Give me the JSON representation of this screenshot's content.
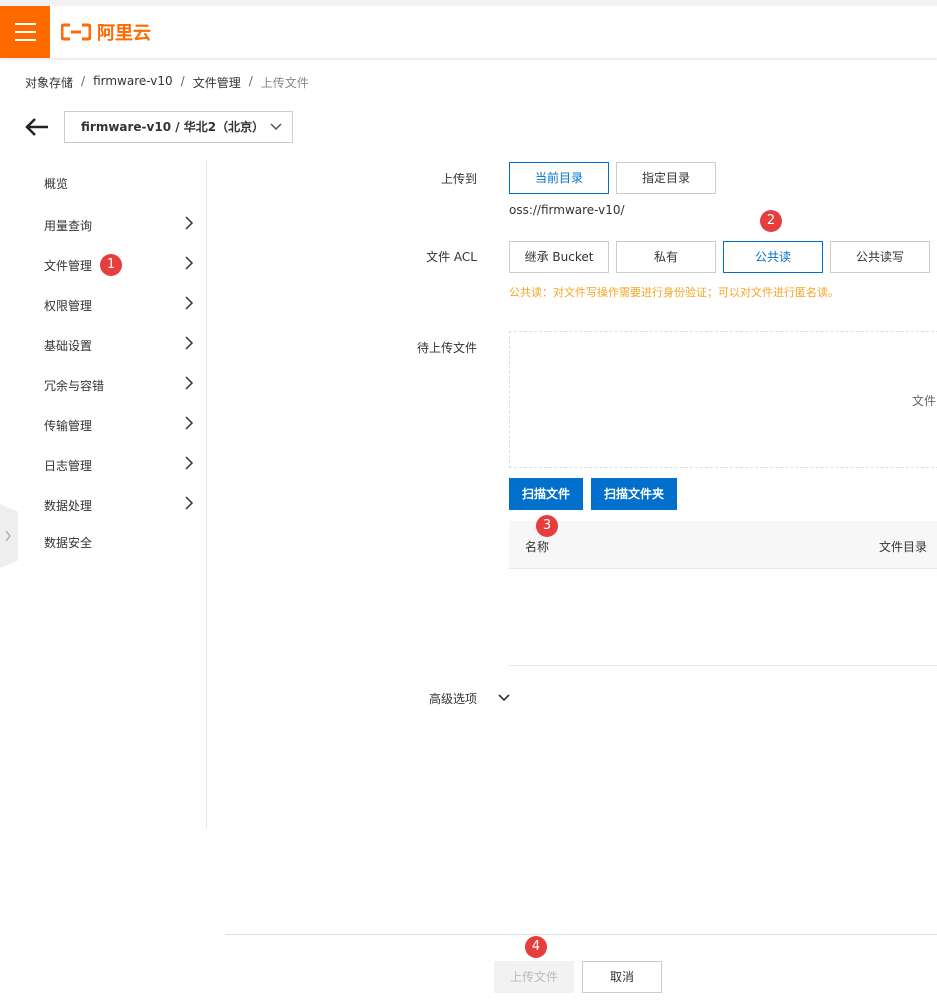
{
  "header": {
    "brand": "阿里云",
    "menu_icon": "hamburger-icon",
    "logo_icon": "aliyun-logo-icon",
    "accent": "#ff6a00"
  },
  "breadcrumb": {
    "items": [
      "对象存储",
      "firmware-v10",
      "文件管理",
      "上传文件"
    ],
    "separator": "/"
  },
  "bucket_selector": {
    "value": "firmware-v10 / 华北2（北京）"
  },
  "sidebar": {
    "items": [
      {
        "label": "概览",
        "has_arrow": false
      },
      {
        "label": "用量查询",
        "has_arrow": true
      },
      {
        "label": "文件管理",
        "has_arrow": true
      },
      {
        "label": "权限管理",
        "has_arrow": true
      },
      {
        "label": "基础设置",
        "has_arrow": true
      },
      {
        "label": "冗余与容错",
        "has_arrow": true
      },
      {
        "label": "传输管理",
        "has_arrow": true
      },
      {
        "label": "日志管理",
        "has_arrow": true
      },
      {
        "label": "数据处理",
        "has_arrow": true
      },
      {
        "label": "数据安全",
        "has_arrow": false
      }
    ]
  },
  "form": {
    "upload_to": {
      "label": "上传到",
      "options": [
        "当前目录",
        "指定目录"
      ],
      "selected": "当前目录",
      "path": "oss://firmware-v10/"
    },
    "acl": {
      "label": "文件 ACL",
      "options": [
        "继承 Bucket",
        "私有",
        "公共读",
        "公共读写"
      ],
      "selected": "公共读",
      "note": "公共读：对文件写操作需要进行身份验证；可以对文件进行匿名读。"
    },
    "pending": {
      "label": "待上传文件",
      "dropzone_text": "文件",
      "scan_files": "扫描文件",
      "scan_folder": "扫描文件夹",
      "columns": [
        "名称",
        "文件目录"
      ]
    },
    "advanced": {
      "label": "高级选项"
    }
  },
  "footer": {
    "upload": "上传文件",
    "cancel": "取消"
  },
  "badges": [
    "1",
    "2",
    "3",
    "4"
  ],
  "colors": {
    "primary": "#0070cc",
    "badge": "#e63d3d",
    "note": "#f5a623"
  }
}
